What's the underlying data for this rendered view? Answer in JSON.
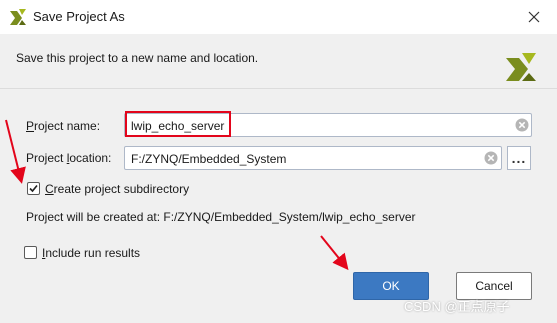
{
  "window": {
    "title": "Save Project As",
    "close_icon": "close-icon",
    "logo_icon": "vivado-logo-icon"
  },
  "header": {
    "description": "Save this project to a new name and location."
  },
  "form": {
    "project_name_label_underlined": "P",
    "project_name_label_rest": "roject name:",
    "project_name_value": "lwip_echo_server",
    "project_location_label_prefix": "Project ",
    "project_location_label_underlined": "l",
    "project_location_label_rest": "ocation:",
    "project_location_value": "F:/ZYNQ/Embedded_System",
    "browse_label": "...",
    "create_subdir_underlined": "C",
    "create_subdir_rest": "reate project subdirectory",
    "create_subdir_checked": true,
    "created_at_text": "Project will be created at: F:/ZYNQ/Embedded_System/lwip_echo_server",
    "include_runs_underlined": "I",
    "include_runs_rest": "nclude run results",
    "include_runs_checked": false
  },
  "buttons": {
    "ok_label": "OK",
    "cancel_label": "Cancel"
  },
  "watermark": "CSDN @正点原子",
  "colors": {
    "accent_blue": "#3c79c2",
    "highlight_red": "#e3051b",
    "arrow_red": "#e3051b"
  }
}
